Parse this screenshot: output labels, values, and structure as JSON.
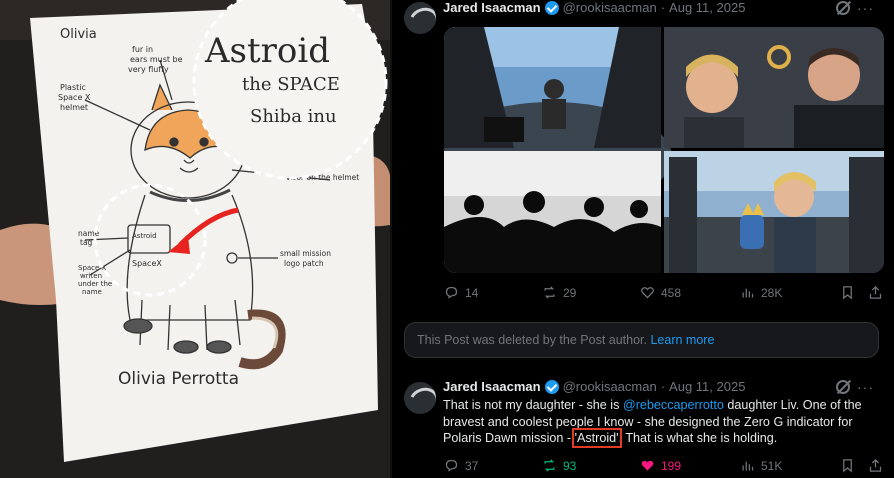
{
  "drawing": {
    "title_line1": "Astroid",
    "title_line2": "the SPACE",
    "title_line3": "Shiba inu",
    "note_fur": "fur in\nears must be\nvery fluffy",
    "note_helmet": "Plastic\nSpace X\nhelmet",
    "note_visor": "visor on the helmet",
    "note_name": "name\ntag",
    "note_writen": "Space X\nwriten\nunder the\nname",
    "note_patch": "small mission\nlogo patch",
    "tag_name": "Astroid",
    "tag_brand": "SpaceX",
    "signature": "Olivia Perrotta",
    "faint_name": "Olivia"
  },
  "post1": {
    "author": "Jared Isaacman",
    "handle": "@rookisaacman",
    "date": "Aug 11, 2025",
    "stats": {
      "replies": "14",
      "reposts": "29",
      "likes": "458",
      "views": "28K"
    }
  },
  "deleted": {
    "text": "This Post was deleted by the Post author.",
    "link": "Learn more"
  },
  "post2": {
    "author": "Jared Isaacman",
    "handle": "@rookisaacman",
    "date": "Aug 11, 2025",
    "text_a": "That is not my daughter - she is ",
    "mention": "@rebeccaperrotto",
    "text_b": " daughter Liv.  One of the bravest and coolest people I know - she designed the Zero G indicator for Polaris Dawn mission - ",
    "highlight": "'Astroid'",
    "text_c": ". That is what she is holding.",
    "stats": {
      "replies": "37",
      "reposts": "93",
      "likes": "199",
      "views": "51K"
    }
  },
  "colors": {
    "background": "#000000",
    "text": "#e7e9ea",
    "muted": "#71767b",
    "link": "#1d9bf0",
    "like": "#f91880",
    "repost": "#00ba7c",
    "highlight_box": "#e23b24"
  }
}
